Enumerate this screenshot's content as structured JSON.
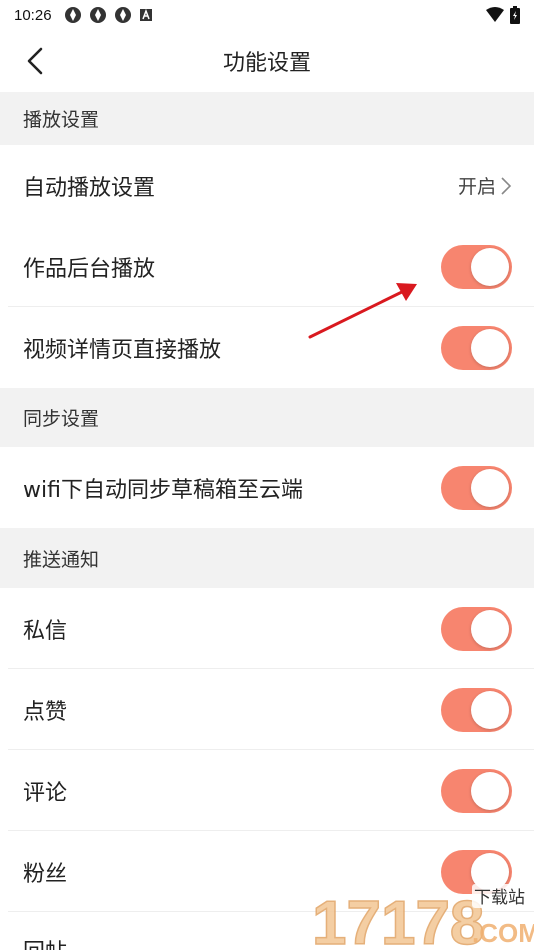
{
  "status_bar": {
    "time": "10:26"
  },
  "header": {
    "title": "功能设置"
  },
  "sections": {
    "playback": {
      "title": "播放设置",
      "autoplay": {
        "label": "自动播放设置",
        "value": "开启"
      },
      "background_play": {
        "label": "作品后台播放",
        "on": true
      },
      "detail_direct_play": {
        "label": "视频详情页直接播放",
        "on": true
      }
    },
    "sync": {
      "title": "同步设置",
      "wifi_sync": {
        "label": "wifi下自动同步草稿箱至云端",
        "on": true
      }
    },
    "push": {
      "title": "推送通知",
      "private_message": {
        "label": "私信",
        "on": true
      },
      "likes": {
        "label": "点赞",
        "on": true
      },
      "comments": {
        "label": "评论",
        "on": true
      },
      "fans": {
        "label": "粉丝",
        "on": true
      },
      "replies": {
        "label": "回帖"
      }
    }
  },
  "watermark": {
    "text": "17178",
    "sub": "下载站",
    "suffix": ".COM"
  },
  "colors": {
    "toggle_on": "#f7856f",
    "section_bg": "#f2f2f2",
    "annotation_arrow": "#d9191f"
  }
}
